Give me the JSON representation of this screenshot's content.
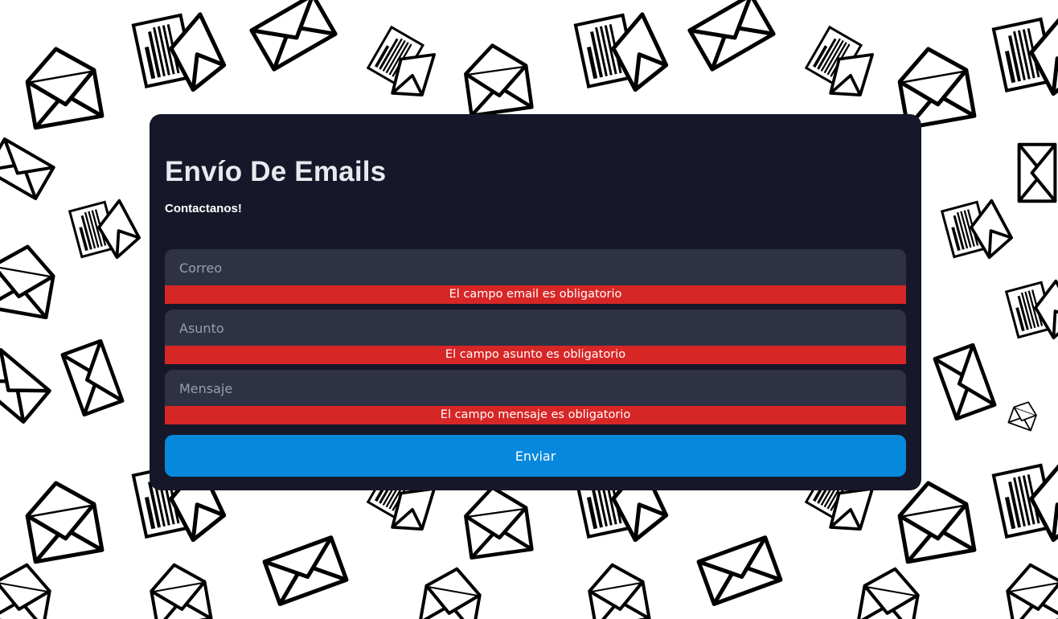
{
  "form": {
    "title": "Envío De Emails",
    "subtitle": "Contactanos!",
    "email": {
      "value": "",
      "placeholder": "Correo",
      "error": "El campo email es obligatorio"
    },
    "subject": {
      "value": "",
      "placeholder": "Asunto",
      "error": "El campo asunto es obligatorio"
    },
    "message": {
      "value": "",
      "placeholder": "Mensaje",
      "error": "El campo mensaje es obligatorio"
    },
    "submit_label": "Enviar"
  },
  "background": {
    "pattern_icon": "envelope-icon"
  },
  "colors": {
    "card": "#161829",
    "field": "#2f3245",
    "error": "#d72626",
    "accent": "#0688dc"
  }
}
